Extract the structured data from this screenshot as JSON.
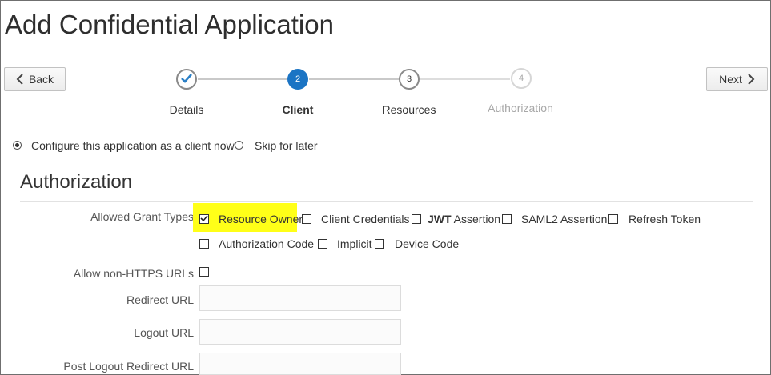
{
  "page": {
    "title": "Add Confidential Application"
  },
  "nav": {
    "back_label": "Back",
    "next_label": "Next"
  },
  "steps": [
    {
      "label": "Details",
      "marker": "",
      "state": "completed"
    },
    {
      "label": "Client",
      "marker": "2",
      "state": "current"
    },
    {
      "label": "Resources",
      "marker": "3",
      "state": "upcoming"
    },
    {
      "label": "Authorization",
      "marker": "4",
      "state": "disabled"
    }
  ],
  "client_config": {
    "options": [
      {
        "label": "Configure this application as a client now",
        "selected": true
      },
      {
        "label": "Skip for later",
        "selected": false
      }
    ]
  },
  "authorization": {
    "title": "Authorization",
    "grant_types_label": "Allowed Grant Types",
    "grant_types": [
      {
        "label": "Resource Owner",
        "checked": true,
        "highlighted": true
      },
      {
        "label": "Client Credentials",
        "checked": false
      },
      {
        "label_bold": "JWT",
        "label_rest": " Assertion",
        "checked": false
      },
      {
        "label": "SAML2 Assertion",
        "checked": false
      },
      {
        "label": "Refresh Token",
        "checked": false
      },
      {
        "label": "Authorization Code",
        "checked": false
      },
      {
        "label": "Implicit",
        "checked": false
      },
      {
        "label": "Device Code",
        "checked": false
      }
    ],
    "allow_non_https_label": "Allow non-HTTPS URLs",
    "allow_non_https_checked": false,
    "redirect_url_label": "Redirect URL",
    "redirect_url_value": "",
    "logout_url_label": "Logout URL",
    "logout_url_value": "",
    "post_logout_redirect_url_label": "Post Logout Redirect URL",
    "post_logout_redirect_url_value": ""
  },
  "colors": {
    "accent": "#1b74c4",
    "completed_check": "#2a7fc6",
    "highlight": "#ffff18"
  }
}
